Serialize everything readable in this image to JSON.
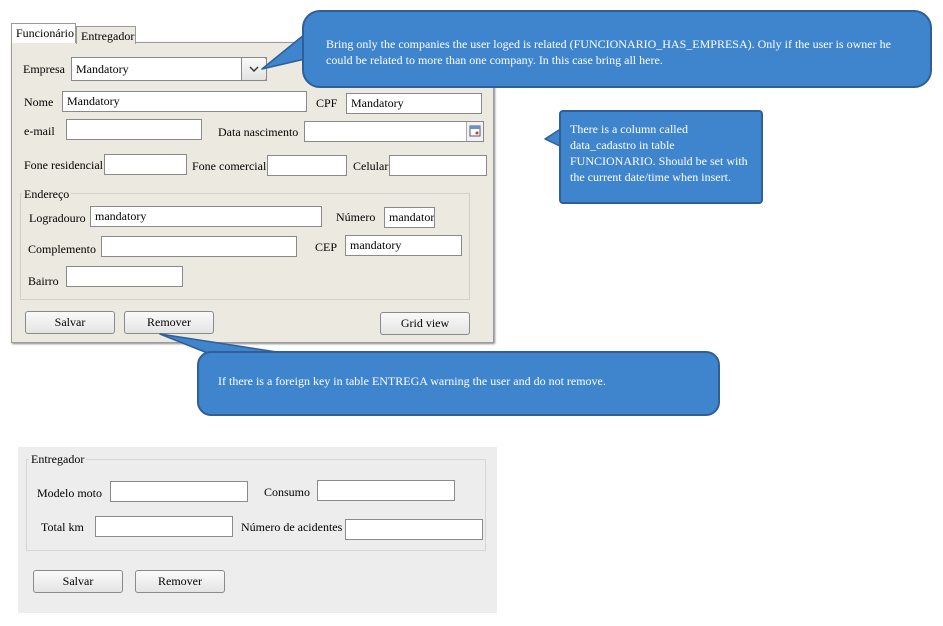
{
  "form1": {
    "tabs": [
      "Funcionário",
      "Entregador"
    ],
    "empresa": {
      "label": "Empresa",
      "value": "Mandatory"
    },
    "nome": {
      "label": "Nome",
      "value": "Mandatory"
    },
    "cpf": {
      "label": "CPF",
      "value": "Mandatory"
    },
    "email": {
      "label": "e-mail",
      "value": ""
    },
    "data_nascimento": {
      "label": "Data nascimento",
      "value": ""
    },
    "fone_residencial": {
      "label": "Fone residencial",
      "value": ""
    },
    "fone_comercial": {
      "label": "Fone comercial",
      "value": ""
    },
    "celular": {
      "label": "Celular",
      "value": ""
    },
    "endereco": {
      "title": "Endereço",
      "logradouro": {
        "label": "Logradouro",
        "value": "mandatory"
      },
      "numero": {
        "label": "Número",
        "value": "mandatory"
      },
      "complemento": {
        "label": "Complemento",
        "value": ""
      },
      "cep": {
        "label": "CEP",
        "value": "mandatory"
      },
      "bairro": {
        "label": "Bairro",
        "value": ""
      }
    },
    "buttons": {
      "salvar": "Salvar",
      "remover": "Remover",
      "grid_view": "Grid view"
    }
  },
  "form2": {
    "title": "Entregador",
    "modelo_moto": {
      "label": "Modelo moto",
      "value": ""
    },
    "consumo": {
      "label": "Consumo",
      "value": ""
    },
    "total_km": {
      "label": "Total km",
      "value": ""
    },
    "numero_acidentes": {
      "label": "Número de acidentes",
      "value": ""
    },
    "buttons": {
      "salvar": "Salvar",
      "remover": "Remover"
    }
  },
  "callouts": {
    "empresa_note": "Bring only the companies the user loged is related (FUNCIONARIO_HAS_EMPRESA). Only if the user is owner  he could be related to more than one company. In this case bring all here.",
    "data_cadastro_note": "There is a column called data_cadastro in table FUNCIONARIO. Should be set with the current date/time when insert.",
    "remover_note": "If there is a foreign key in table ENTREGA  warning the user and do not remove."
  },
  "colors": {
    "callout_fill": "#3f85ce",
    "callout_border": "#2f5f96",
    "form_bg": "#ece9e0",
    "form2_bg": "#ededed"
  }
}
